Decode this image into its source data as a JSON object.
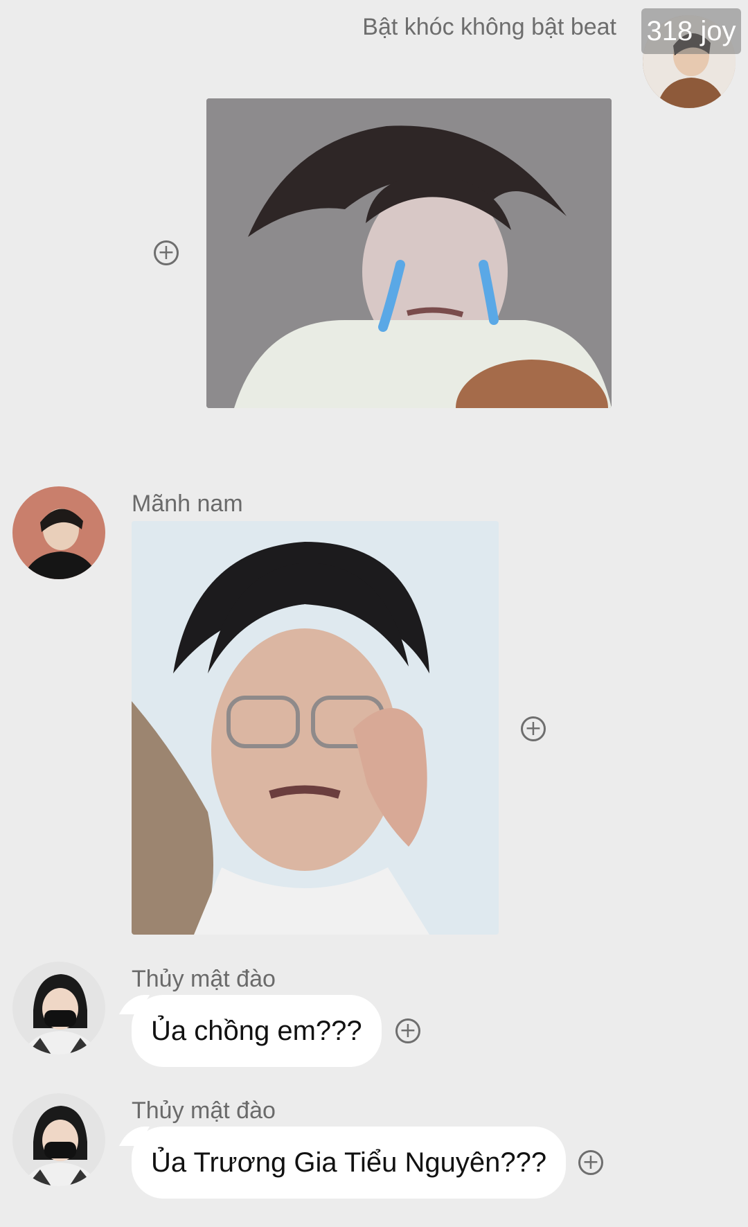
{
  "messages": [
    {
      "sender_side": "right",
      "text": "Bật khóc không bật beat",
      "avatar_badge": "318 joy"
    },
    {
      "sender_side": "right",
      "type": "image",
      "image_icon": "crying-meme-image"
    },
    {
      "sender_side": "left",
      "sender_name": "Mãnh nam",
      "type": "image",
      "image_icon": "crying-glasses-meme-image"
    },
    {
      "sender_side": "left",
      "sender_name": "Thủy mật đào",
      "text": "Ủa chồng em???"
    },
    {
      "sender_side": "left",
      "sender_name": "Thủy mật đào",
      "text": "Ủa Trương Gia Tiểu Nguyên???"
    }
  ],
  "icons": {
    "add_reaction": "circle-plus-icon"
  },
  "colors": {
    "background": "#ececec",
    "bubble": "#ffffff",
    "name_text": "#6a6a6a",
    "tear_blue": "#5aa8e6"
  }
}
